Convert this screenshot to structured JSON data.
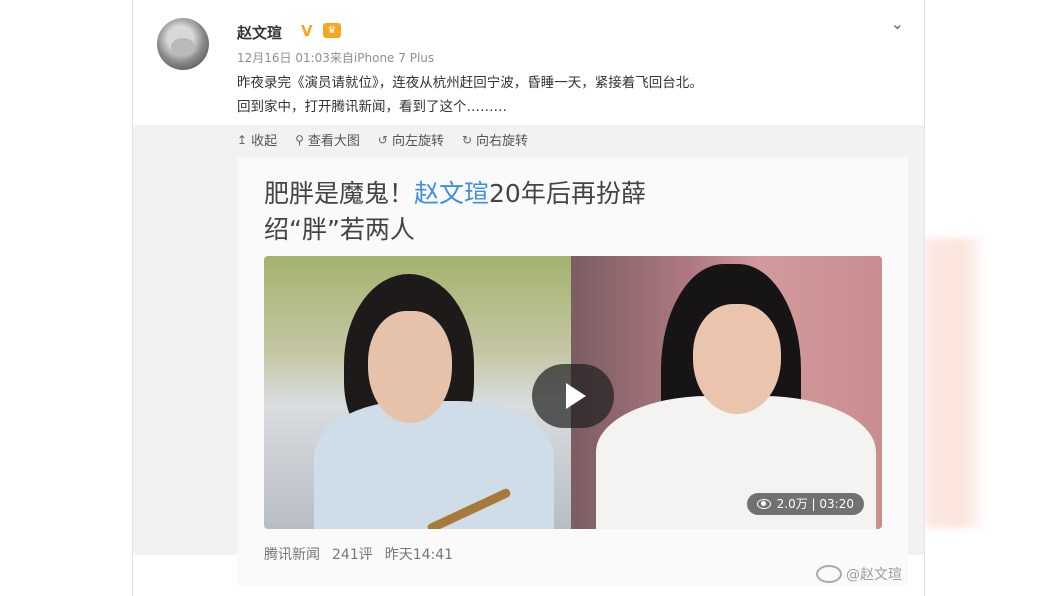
{
  "post": {
    "username": "赵文瑄",
    "verified_badge": "V",
    "crown_badge": "👑",
    "meta": "12月16日 01:03来自iPhone 7 Plus",
    "menu_icon": "chevron-down",
    "text_line1": "昨夜录完《演员请就位》，连夜从杭州赶回宁波，昏睡一天，紧接着飞回台北。",
    "text_line2": "回到家中，打开腾讯新闻，看到了这个………"
  },
  "toolbar": {
    "collapse": "收起",
    "view_large": "查看大图",
    "rotate_left": "向左旋转",
    "rotate_right": "向右旋转"
  },
  "preview": {
    "headline_prefix": "肥胖是魔鬼！",
    "headline_name": "赵文瑄",
    "headline_suffix": "20年后再扮薛",
    "headline_line2": "绍“胖”若两人",
    "video_stats": "2.0万 | 03:20",
    "source": "腾讯新闻",
    "comments": "241评",
    "time": "昨天14:41"
  },
  "watermark": "@赵文瑄"
}
